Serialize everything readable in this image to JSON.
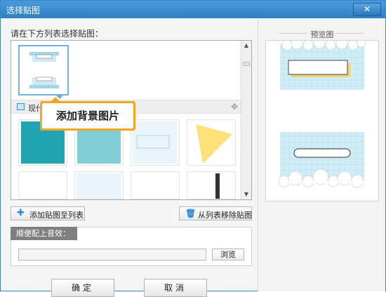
{
  "window": {
    "title": "选择贴图",
    "close_label": "✕"
  },
  "instruction": "请在下方列表选择贴图：",
  "category": {
    "label": "现代东",
    "move_icon": "move-icon"
  },
  "tooltip": {
    "text": "添加背景图片"
  },
  "buttons": {
    "add_to_list": "添加贴图至列表",
    "remove_from_list": "从列表移除贴图",
    "browse": "浏览",
    "ok": "确定",
    "cancel": "取消"
  },
  "sound": {
    "label": "顺便配上音效：",
    "path_value": ""
  },
  "preview": {
    "title": "预览图"
  },
  "colors": {
    "accent": "#3a86c8",
    "tooltip_orange": "#f5a623",
    "thumb_teal": "#1fa5b0",
    "preview_grid": "#bfe3f0"
  }
}
